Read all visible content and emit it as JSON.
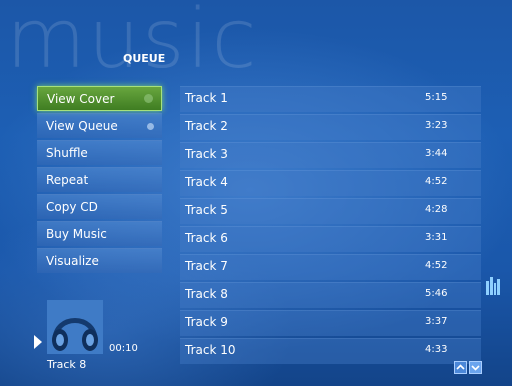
{
  "background": {
    "watermark_text": "music"
  },
  "header": {
    "section_title": "QUEUE"
  },
  "menu": {
    "items": [
      {
        "label": "View Cover",
        "focused": true
      },
      {
        "label": "View Queue"
      },
      {
        "label": "Shuffle"
      },
      {
        "label": "Repeat"
      },
      {
        "label": "Copy CD"
      },
      {
        "label": "Buy Music"
      },
      {
        "label": "Visualize"
      }
    ]
  },
  "tracks": [
    {
      "name": "Track 1",
      "duration": "5:15"
    },
    {
      "name": "Track 2",
      "duration": "3:23"
    },
    {
      "name": "Track 3",
      "duration": "3:44"
    },
    {
      "name": "Track 4",
      "duration": "4:52"
    },
    {
      "name": "Track 5",
      "duration": "4:28"
    },
    {
      "name": "Track 6",
      "duration": "3:31"
    },
    {
      "name": "Track 7",
      "duration": "4:52"
    },
    {
      "name": "Track 8",
      "duration": "5:46"
    },
    {
      "name": "Track 9",
      "duration": "3:37"
    },
    {
      "name": "Track 10",
      "duration": "4:33"
    }
  ],
  "now_playing": {
    "elapsed": "00:10",
    "track": "Track 8",
    "state_icon": "play-icon",
    "art_icon": "headphones-icon"
  },
  "icons": {
    "equalizer": "equalizer-icon",
    "scroll_up": "arrow-up-icon",
    "scroll_down": "arrow-down-icon"
  },
  "colors": {
    "focus_green": "#5a9a33",
    "background_blue": "#1d5fb4",
    "text": "#ffffff"
  }
}
